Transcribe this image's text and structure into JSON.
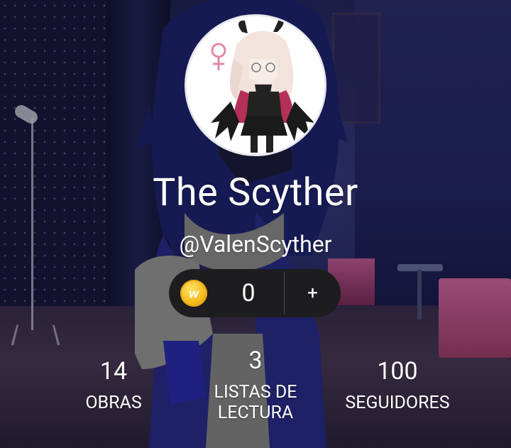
{
  "profile": {
    "display_name": "The Scyther",
    "username": "@ValenScyther"
  },
  "coins": {
    "count": "0",
    "add_label": "+",
    "icon": "wattpad-coin-icon"
  },
  "stats": [
    {
      "value": "14",
      "label": "OBRAS"
    },
    {
      "value": "3",
      "label": "LISTAS DE LECTURA"
    },
    {
      "value": "100",
      "label": "SEGUIDORES"
    }
  ],
  "colors": {
    "coin_pill_bg": "#1d1d1f",
    "coin_gold": "#f3b91b",
    "text": "#ffffff"
  }
}
